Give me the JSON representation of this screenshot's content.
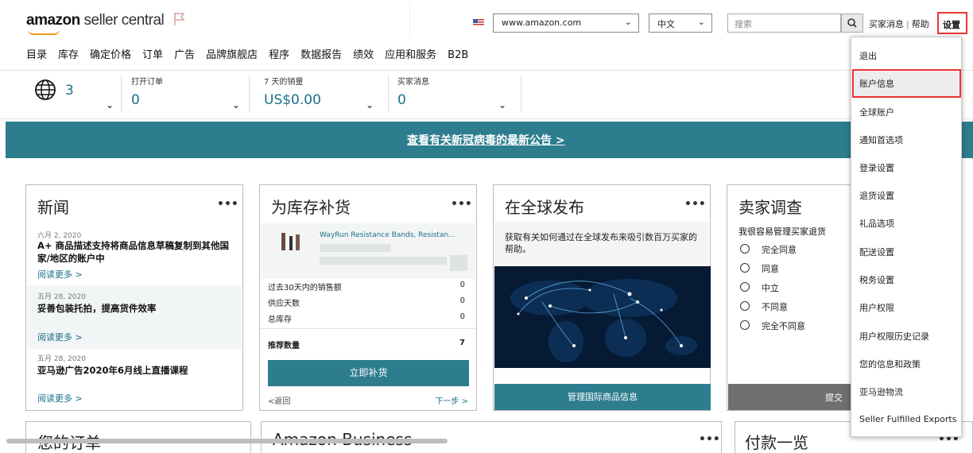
{
  "header": {
    "logo_amazon": "amazon",
    "logo_seller": "seller central",
    "marketplace": "www.amazon.com",
    "language": "中文",
    "search_placeholder": "搜索",
    "buyer_messages": "买家消息",
    "help": "帮助",
    "settings": "设置"
  },
  "nav": [
    "目录",
    "库存",
    "确定价格",
    "订单",
    "广告",
    "品牌旗舰店",
    "程序",
    "数据报告",
    "绩效",
    "应用和服务",
    "B2B"
  ],
  "metrics": {
    "globe_count": "3",
    "open_orders_label": "打开订单",
    "open_orders_value": "0",
    "sales_label": "7 天的销量",
    "sales_value": "US$0.00",
    "buyer_msg_label": "买家消息",
    "buyer_msg_value": "0"
  },
  "banner": "查看有关新冠病毒的最新公告 >",
  "news": {
    "title": "新闻",
    "items": [
      {
        "date": "六月 2, 2020",
        "headline": "A+ 商品描述支持将商品信息草稿复制到其他国家/地区的账户中",
        "more": "阅读更多 >"
      },
      {
        "date": "五月 28, 2020",
        "headline": "妥善包装托拍，提高货件效率",
        "more": "阅读更多 >"
      },
      {
        "date": "五月 28, 2020",
        "headline": "亚马逊广告2020年6月线上直播课程",
        "more": "阅读更多 >"
      }
    ]
  },
  "restock": {
    "title": "为库存补货",
    "product": "WayRun Resistance Bands, Resistan...",
    "rows": [
      {
        "label": "过去30天内的销售额",
        "value": "0"
      },
      {
        "label": "供应天数",
        "value": "0"
      },
      {
        "label": "总库存",
        "value": "0"
      }
    ],
    "recommended_label": "推荐数量",
    "recommended_value": "7",
    "button": "立即补货",
    "back": "<返回",
    "next": "下一步 >"
  },
  "global": {
    "title": "在全球发布",
    "text": "获取有关如何通过在全球发布来吸引数百万买家的帮助。",
    "button": "管理国际商品信息"
  },
  "survey": {
    "title": "卖家调查",
    "question": "我很容易管理买家退货",
    "options": [
      "完全同意",
      "同意",
      "中立",
      "不同意",
      "完全不同意"
    ],
    "submit": "提交"
  },
  "bottom_cards": {
    "orders": "您的订单",
    "business": "Amazon Business",
    "payments": "付款一览"
  },
  "settings_menu": [
    "退出",
    "账户信息",
    "全球账户",
    "通知首选项",
    "登录设置",
    "退货设置",
    "礼品选项",
    "配送设置",
    "税务设置",
    "用户权限",
    "用户权限历史记录",
    "您的信息和政策",
    "亚马逊物流",
    "Seller Fulfilled Exports"
  ],
  "colors": {
    "teal": "#2d7d8f",
    "highlight": "#e33333",
    "logo_orange": "#f29a1a"
  }
}
